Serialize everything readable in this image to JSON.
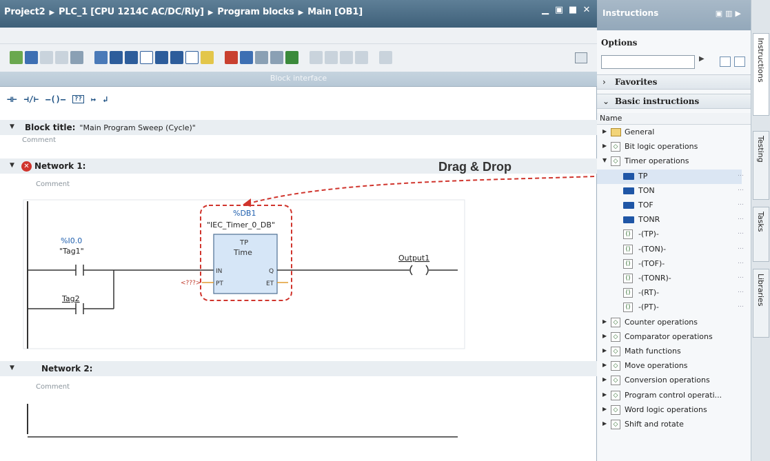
{
  "editor": {
    "breadcrumb": [
      "Project2",
      "PLC_1 [CPU 1214C AC/DC/Rly]",
      "Program blocks",
      "Main [OB1]"
    ],
    "block_interface_label": "Block interface",
    "block_title_label": "Block title:",
    "block_title_value": "\"Main Program Sweep (Cycle)\"",
    "comment_label": "Comment",
    "network1": {
      "label": "Network 1:",
      "comment": "Comment",
      "contact1_address": "%I0.0",
      "contact1_tag": "\"Tag1\"",
      "contact2_tag": "Tag2",
      "timer_db_address": "%DB1",
      "timer_db_name": "\"IEC_Timer_0_DB\"",
      "timer_type": "TP",
      "timer_datatype": "Time",
      "pin_in": "IN",
      "pin_pt": "PT",
      "pin_q": "Q",
      "pin_et": "ET",
      "pt_value": "<???>",
      "coil_tag": "Output1"
    },
    "network2": {
      "label": "Network 2:",
      "comment": "Comment"
    },
    "annotation": "Drag & Drop"
  },
  "instructions": {
    "title": "Instructions",
    "options_label": "Options",
    "favorites": "Favorites",
    "basic_instructions": "Basic instructions",
    "name_header": "Name",
    "tree": [
      {
        "label": "General",
        "icon": "folder-icon",
        "level": 0,
        "expanded": false
      },
      {
        "label": "Bit logic operations",
        "icon": "bit-logic-icon",
        "level": 0,
        "expanded": false
      },
      {
        "label": "Timer operations",
        "icon": "timer-icon",
        "level": 0,
        "expanded": true
      },
      {
        "label": "TP",
        "icon": "timer-box-icon",
        "level": 1
      },
      {
        "label": "TON",
        "icon": "timer-box-icon",
        "level": 1
      },
      {
        "label": "TOF",
        "icon": "timer-box-icon",
        "level": 1
      },
      {
        "label": "TONR",
        "icon": "timer-box-icon",
        "level": 1
      },
      {
        "label": "-(TP)-",
        "icon": "coil-icon",
        "level": 1
      },
      {
        "label": "-(TON)-",
        "icon": "coil-icon",
        "level": 1
      },
      {
        "label": "-(TOF)-",
        "icon": "coil-icon",
        "level": 1
      },
      {
        "label": "-(TONR)-",
        "icon": "coil-icon",
        "level": 1
      },
      {
        "label": "-(RT)-",
        "icon": "coil-icon",
        "level": 1
      },
      {
        "label": "-(PT)-",
        "icon": "coil-icon",
        "level": 1
      },
      {
        "label": "Counter operations",
        "icon": "counter-icon",
        "level": 0,
        "expanded": false
      },
      {
        "label": "Comparator operations",
        "icon": "comparator-icon",
        "level": 0,
        "expanded": false
      },
      {
        "label": "Math functions",
        "icon": "math-icon",
        "level": 0,
        "expanded": false
      },
      {
        "label": "Move operations",
        "icon": "move-icon",
        "level": 0,
        "expanded": false
      },
      {
        "label": "Conversion operations",
        "icon": "conversion-icon",
        "level": 0,
        "expanded": false
      },
      {
        "label": "Program control operati...",
        "icon": "program-control-icon",
        "level": 0,
        "expanded": false
      },
      {
        "label": "Word logic operations",
        "icon": "word-logic-icon",
        "level": 0,
        "expanded": false
      },
      {
        "label": "Shift and rotate",
        "icon": "shift-rotate-icon",
        "level": 0,
        "expanded": false
      }
    ]
  },
  "side_tabs": [
    "Instructions",
    "Testing",
    "Tasks",
    "Libraries"
  ],
  "colors": {
    "title_bar": "#3e6079",
    "annotation_red": "#d0342c",
    "tag_blue": "#1f5fae",
    "timer_box": "#d6e6f7"
  }
}
